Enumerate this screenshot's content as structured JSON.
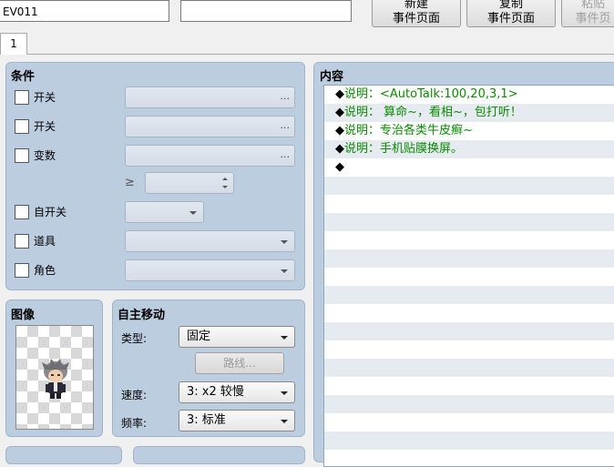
{
  "event": {
    "name_value": "EV011",
    "note_value": ""
  },
  "toolbar": {
    "new_page": [
      "新建",
      "事件页面"
    ],
    "copy_page": [
      "复制",
      "事件页面"
    ],
    "paste_page": [
      "粘贴",
      "事件页"
    ]
  },
  "tabs": [
    {
      "label": "1"
    }
  ],
  "conditions": {
    "title": "条件",
    "switch1_label": "开关",
    "switch2_label": "开关",
    "variable_label": "变数",
    "operator": "≥",
    "self_switch_label": "自开关",
    "item_label": "道具",
    "actor_label": "角色",
    "ellipsis": "..."
  },
  "image": {
    "title": "图像"
  },
  "autonomous_movement": {
    "title": "自主移动",
    "type_label": "类型:",
    "type_value": "固定",
    "route_button": "路线...",
    "speed_label": "速度:",
    "speed_value": "3: x2 较慢",
    "freq_label": "频率:",
    "freq_value": "3: 标准"
  },
  "contents": {
    "title": "内容",
    "marker": "◆",
    "lines": [
      "说明：<AutoTalk:100,20,3,1>",
      "说明： 算命~，看相~，包打听！",
      "说明：专治各类牛皮癣~",
      "说明：手机贴膜换屏。",
      ""
    ]
  },
  "colors": {
    "panel_bg": "#bdcde0",
    "comment_text": "#0a8a00",
    "alt_row": "#e6ebf1"
  }
}
